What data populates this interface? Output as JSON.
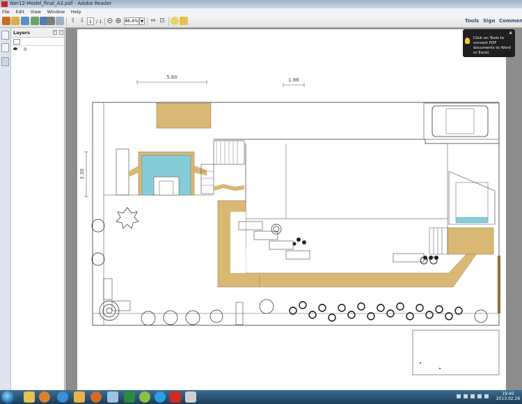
{
  "window": {
    "title": "Iker12-Model_final_A3.pdf - Adobe Reader"
  },
  "menu": [
    "File",
    "Edit",
    "View",
    "Window",
    "Help"
  ],
  "toolbar": {
    "page_current": "1",
    "page_total": "/ 1",
    "zoom": "86,4%",
    "tools_label": "Tools",
    "sign_label": "Sign",
    "comment_label": "Comment"
  },
  "layers": {
    "title": "Layers",
    "items": [
      {
        "name": "0"
      }
    ]
  },
  "tooltip": {
    "text": "Click on Tools to convert PDF documents to Word or Excel."
  },
  "drawing": {
    "dims": [
      "5.60",
      "1.86",
      "3.30"
    ]
  },
  "taskbar": {
    "time": "19:40",
    "date": "2013.02.26"
  },
  "colors": {
    "sand": "#d9b876",
    "pool": "#87cdd9",
    "taskbar": "#1f4a6e",
    "accent": "#2a4d7c"
  }
}
